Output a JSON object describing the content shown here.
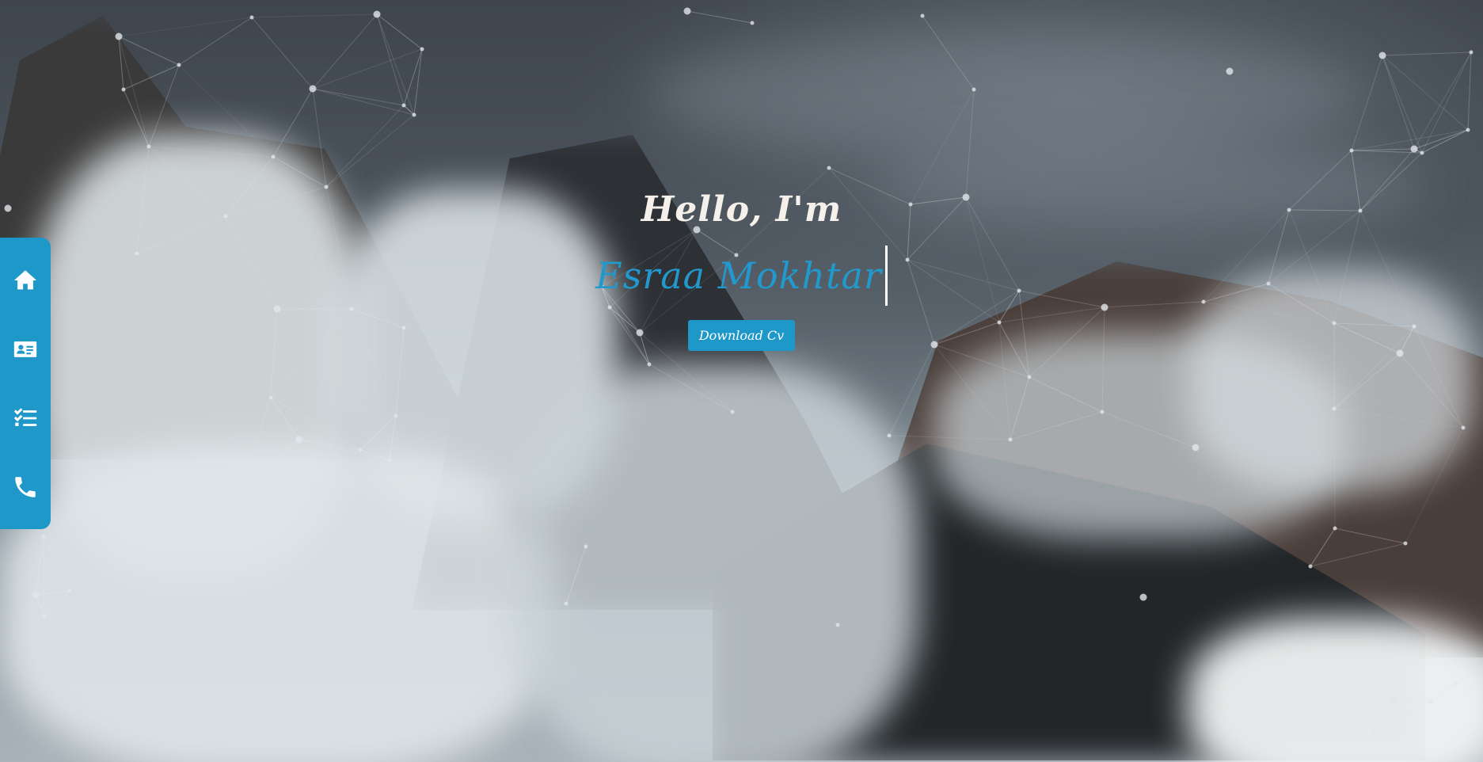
{
  "hero": {
    "greeting": "Hello, I'm",
    "name": "Esraa Mokhtar",
    "download_label": "Download Cv"
  },
  "sidebar": {
    "items": [
      {
        "id": "home",
        "icon": "home-icon"
      },
      {
        "id": "about",
        "icon": "id-card-icon"
      },
      {
        "id": "skills",
        "icon": "checklist-icon"
      },
      {
        "id": "contact",
        "icon": "phone-icon"
      }
    ]
  },
  "colors": {
    "accent": "#1e98c8",
    "name_text": "#2299cc",
    "greeting_text": "#f5f1ea"
  }
}
